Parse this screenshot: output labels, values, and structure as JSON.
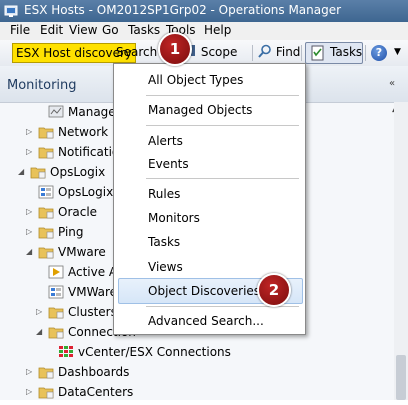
{
  "window": {
    "title": "ESX Hosts - OM2012SP1Grp02 - Operations Manager"
  },
  "menubar": [
    "File",
    "Edit",
    "View",
    "Go",
    "Tasks",
    "Tools",
    "Help"
  ],
  "toolbar": {
    "search_value": "ESX Host discovery",
    "search_button": "Search",
    "scope": "Scope",
    "find": "Find",
    "tasks": "Tasks"
  },
  "pane": {
    "title": "Monitoring"
  },
  "tree": [
    {
      "label": "Manager",
      "icon": "monitor-view-icon"
    },
    {
      "label": "Network D",
      "icon": "folder-icon"
    },
    {
      "label": "Notification",
      "icon": "folder-icon"
    },
    {
      "label": "OpsLogix",
      "icon": "folder-icon"
    },
    {
      "label": "OpsLogix L",
      "icon": "state-view-icon"
    },
    {
      "label": "Oracle",
      "icon": "folder-icon"
    },
    {
      "label": "Ping",
      "icon": "folder-icon"
    },
    {
      "label": "VMware",
      "icon": "folder-icon"
    },
    {
      "label": "Active Ale",
      "icon": "alert-view-icon"
    },
    {
      "label": "VMWare",
      "icon": "state-view-icon"
    },
    {
      "label": "Clusters",
      "icon": "folder-icon"
    },
    {
      "label": "Connection",
      "icon": "folder-icon"
    },
    {
      "label": "vCenter/ESX Connections",
      "icon": "grid-view-icon"
    },
    {
      "label": "Dashboards",
      "icon": "folder-icon"
    },
    {
      "label": "DataCenters",
      "icon": "folder-icon"
    }
  ],
  "dropdown": [
    "All Object Types",
    "Managed Objects",
    "Alerts",
    "Events",
    "Rules",
    "Monitors",
    "Tasks",
    "Views",
    "Object Discoveries",
    "Advanced Search..."
  ],
  "highlighted_item": "Object Discoveries",
  "callouts": [
    "1",
    "2"
  ],
  "colors": {
    "search_highlight": "#ffe100",
    "callout": "#9b1414",
    "titlebar": "#4a709a"
  }
}
